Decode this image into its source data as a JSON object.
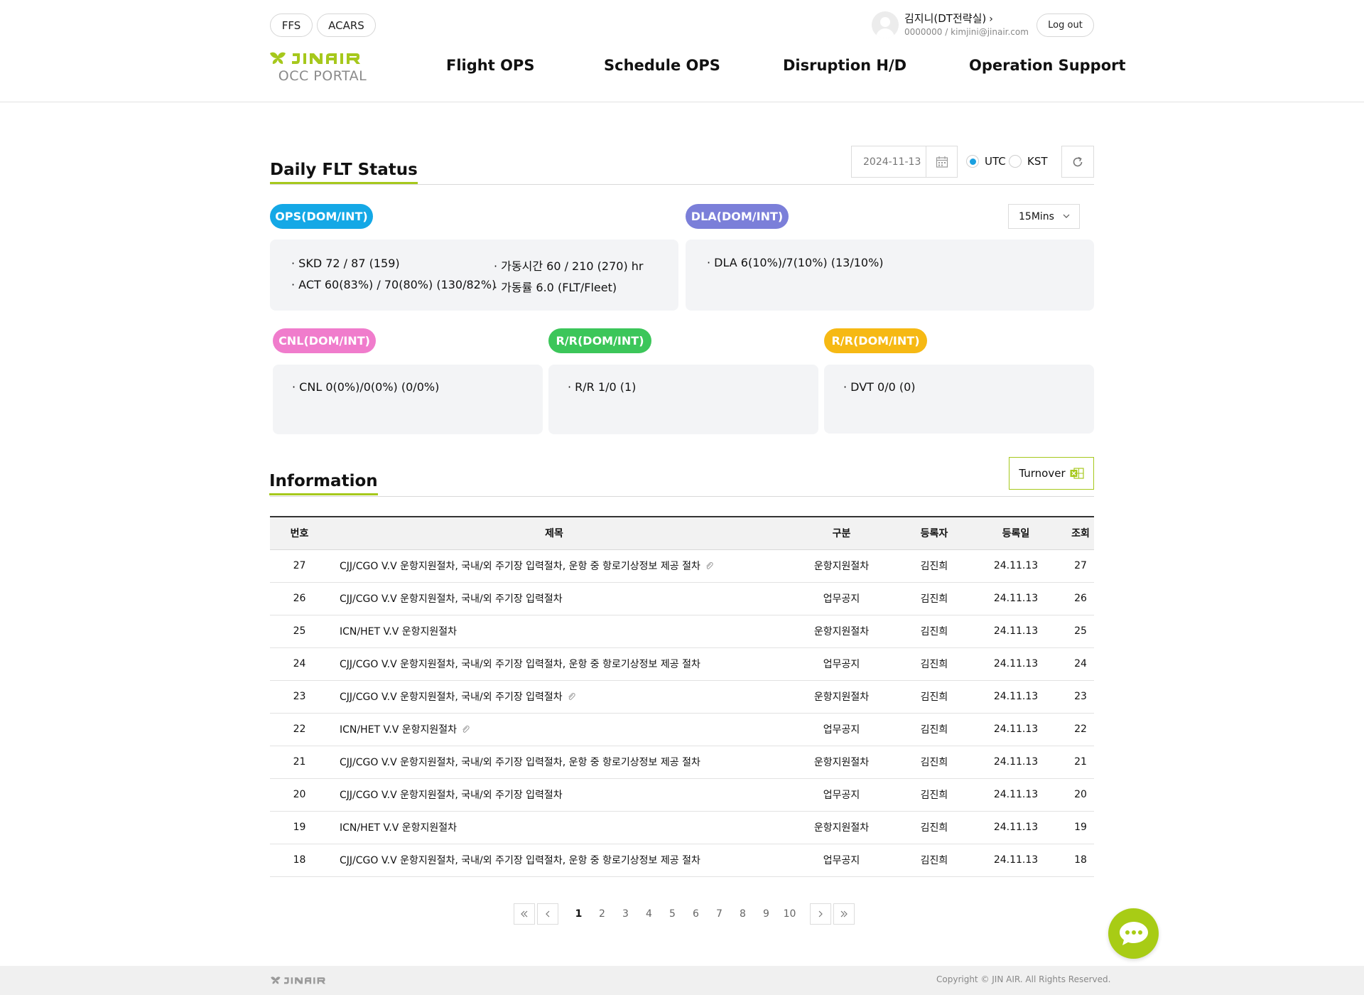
{
  "header": {
    "util_buttons": [
      "FFS",
      "ACARS"
    ],
    "logo_sub": "OCC PORTAL",
    "nav": [
      "Flight OPS",
      "Schedule OPS",
      "Disruption H/D",
      "Operation Support"
    ],
    "user_name": "김지니(DT전략실)",
    "user_meta": "0000000 / kimjini@jinair.com",
    "logout_label": "Log out"
  },
  "daily": {
    "title": "Daily FLT Status",
    "date_placeholder": "2024-11-13",
    "tz_options": [
      "UTC",
      "KST"
    ],
    "tz_selected": "UTC",
    "interval": "15Mins",
    "cards": {
      "ops": {
        "label": "OPS(DOM/INT)",
        "color": "#14a8e6",
        "lines": [
          "· SKD 72 / 87 (159)",
          "· ACT 60(83%) / 70(80%) (130/82%)",
          "· 가동시간 60 / 210 (270) hr",
          "· 가동률 6.0 (FLT/Fleet)"
        ]
      },
      "dla": {
        "label": "DLA(DOM/INT)",
        "color": "#7b7fd9",
        "lines": [
          "· DLA 6(10%)/7(10%) (13/10%)"
        ]
      },
      "cnl": {
        "label": "CNL(DOM/INT)",
        "color": "#f07ccc",
        "lines": [
          "· CNL 0(0%)/0(0%) (0/0%)"
        ]
      },
      "rr": {
        "label": "R/R(DOM/INT)",
        "color": "#3cc65a",
        "lines": [
          "· R/R 1/0 (1)"
        ]
      },
      "dvt": {
        "label": "R/R(DOM/INT)",
        "color": "#f6b914",
        "lines": [
          "· DVT 0/0 (0)"
        ]
      }
    }
  },
  "info": {
    "title": "Information",
    "turnover_label": "Turnover",
    "columns": [
      "번호",
      "제목",
      "구분",
      "등록자",
      "등록일",
      "조회"
    ],
    "rows": [
      {
        "no": "27",
        "title": "CJJ/CGO V.V 운항지원절차, 국내/외 주기장 입력절차, 운항 중 항로기상정보 제공 절차",
        "attach": true,
        "type": "운항지원절차",
        "author": "김진희",
        "date": "24.11.13",
        "views": "27"
      },
      {
        "no": "26",
        "title": "CJJ/CGO V.V 운항지원절차, 국내/외 주기장 입력절차",
        "attach": false,
        "type": "업무공지",
        "author": "김진희",
        "date": "24.11.13",
        "views": "26"
      },
      {
        "no": "25",
        "title": "ICN/HET V.V 운항지원절차",
        "attach": false,
        "type": "운항지원절차",
        "author": "김진희",
        "date": "24.11.13",
        "views": "25"
      },
      {
        "no": "24",
        "title": "CJJ/CGO V.V 운항지원절차, 국내/외 주기장 입력절차, 운항 중 항로기상정보 제공 절차",
        "attach": false,
        "type": "업무공지",
        "author": "김진희",
        "date": "24.11.13",
        "views": "24"
      },
      {
        "no": "23",
        "title": "CJJ/CGO V.V 운항지원절차, 국내/외 주기장 입력절차",
        "attach": true,
        "type": "운항지원절차",
        "author": "김진희",
        "date": "24.11.13",
        "views": "23"
      },
      {
        "no": "22",
        "title": "ICN/HET V.V 운항지원절차",
        "attach": true,
        "type": "업무공지",
        "author": "김진희",
        "date": "24.11.13",
        "views": "22"
      },
      {
        "no": "21",
        "title": "CJJ/CGO V.V 운항지원절차, 국내/외 주기장 입력절차, 운항 중 항로기상정보 제공 절차",
        "attach": false,
        "type": "운항지원절차",
        "author": "김진희",
        "date": "24.11.13",
        "views": "21"
      },
      {
        "no": "20",
        "title": "CJJ/CGO V.V 운항지원절차, 국내/외 주기장 입력절차",
        "attach": false,
        "type": "업무공지",
        "author": "김진희",
        "date": "24.11.13",
        "views": "20"
      },
      {
        "no": "19",
        "title": "ICN/HET V.V 운항지원절차",
        "attach": false,
        "type": "운항지원절차",
        "author": "김진희",
        "date": "24.11.13",
        "views": "19"
      },
      {
        "no": "18",
        "title": "CJJ/CGO V.V 운항지원절차, 국내/외 주기장 입력절차, 운항 중 항로기상정보 제공 절차",
        "attach": false,
        "type": "업무공지",
        "author": "김진희",
        "date": "24.11.13",
        "views": "18"
      }
    ]
  },
  "pagination": {
    "pages": [
      "1",
      "2",
      "3",
      "4",
      "5",
      "6",
      "7",
      "8",
      "9",
      "10"
    ],
    "current": "1"
  },
  "footer": {
    "copyright": "Copyright © JIN AIR. All Rights Reserved."
  },
  "colors": {
    "accent": "#a6c81c",
    "radio_on": "#1aa0e0"
  }
}
